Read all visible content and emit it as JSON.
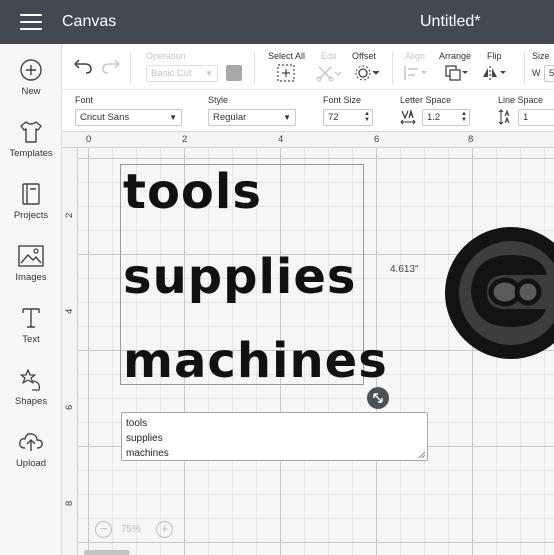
{
  "header": {
    "app_title": "Canvas",
    "doc_title": "Untitled*"
  },
  "sidebar": {
    "items": [
      {
        "label": "New",
        "icon": "plus-circle-icon"
      },
      {
        "label": "Templates",
        "icon": "tshirt-icon"
      },
      {
        "label": "Projects",
        "icon": "book-icon"
      },
      {
        "label": "Images",
        "icon": "image-icon"
      },
      {
        "label": "Text",
        "icon": "text-t-icon"
      },
      {
        "label": "Shapes",
        "icon": "shapes-icon"
      },
      {
        "label": "Upload",
        "icon": "cloud-upload-icon"
      }
    ]
  },
  "toolbar": {
    "operation_label": "Operation",
    "operation_value": "Basic Cut",
    "select_all_label": "Select All",
    "edit_label": "Edit",
    "offset_label": "Offset",
    "align_label": "Align",
    "arrange_label": "Arrange",
    "flip_label": "Flip",
    "size_label": "Size",
    "size_w_label": "W",
    "size_w_value": "5"
  },
  "text_toolbar": {
    "font_label": "Font",
    "font_value": "Cricut Sans",
    "style_label": "Style",
    "style_value": "Regular",
    "font_size_label": "Font Size",
    "font_size_value": "72",
    "letter_space_label": "Letter Space",
    "letter_space_value": "1.2",
    "line_space_label": "Line Space",
    "line_space_value": "1"
  },
  "ruler": {
    "top": [
      "0",
      "2",
      "4",
      "6",
      "8"
    ],
    "left": [
      "2",
      "4",
      "6",
      "8"
    ]
  },
  "canvas": {
    "text_lines": [
      "tools",
      "supplies",
      "machines"
    ],
    "dimension_label": "4.613\"",
    "edit_box_lines": [
      "tools",
      "supplies",
      "machines"
    ]
  },
  "zoom": {
    "value": "75%",
    "minus": "−",
    "plus": "+"
  },
  "colors": {
    "header_bg": "#414a51",
    "swatch": "#a9a9a9"
  }
}
